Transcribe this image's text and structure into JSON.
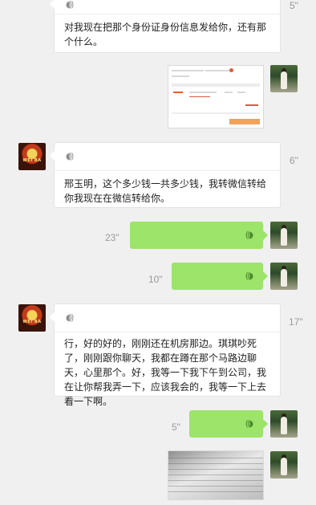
{
  "messages": [
    {
      "id": "m1",
      "sender": "contact",
      "duration": "5\"",
      "transcript": "对我现在把那个身份证身份信息发给你，还有那个什么。"
    },
    {
      "id": "m2",
      "sender": "me",
      "type": "image",
      "description": "order-screenshot"
    },
    {
      "id": "m3",
      "sender": "contact",
      "duration": "6\"",
      "transcript": "邢玉明，这个多少钱一共多少钱，我转微信转给你我现在在微信转给你。"
    },
    {
      "id": "m4",
      "sender": "me",
      "duration": "23\""
    },
    {
      "id": "m5",
      "sender": "me",
      "duration": "10\""
    },
    {
      "id": "m6",
      "sender": "contact",
      "duration": "17\"",
      "transcript": "行，好的好的，刚刚还在机房那边。琪琪吵死了，刚刚跟你聊天，我都在蹲在那个马路边聊天，心里那个。好，我等一下我下午到公司，我在让你帮我弄一下，应该我会的，我等一下上去看一下啊。"
    },
    {
      "id": "m7",
      "sender": "me",
      "duration": "5\""
    },
    {
      "id": "m8",
      "sender": "me",
      "type": "image",
      "description": "photo"
    }
  ],
  "contact_avatar": {
    "logo_text": "WEI BA"
  },
  "colors": {
    "background": "#f0f0f0",
    "incoming_bubble": "#ffffff",
    "outgoing_bubble": "#9de46a",
    "duration_text": "#9a9a9a"
  }
}
